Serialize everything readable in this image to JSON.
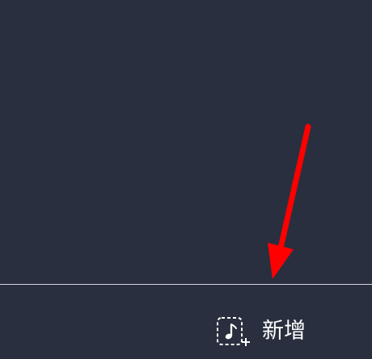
{
  "toolbar": {
    "add_label": "新增",
    "add_icon": "add-music-icon"
  },
  "colors": {
    "background": "#292f3e",
    "divider": "#d3d6dc",
    "text": "#ffffff",
    "annotation": "#ff0000"
  }
}
